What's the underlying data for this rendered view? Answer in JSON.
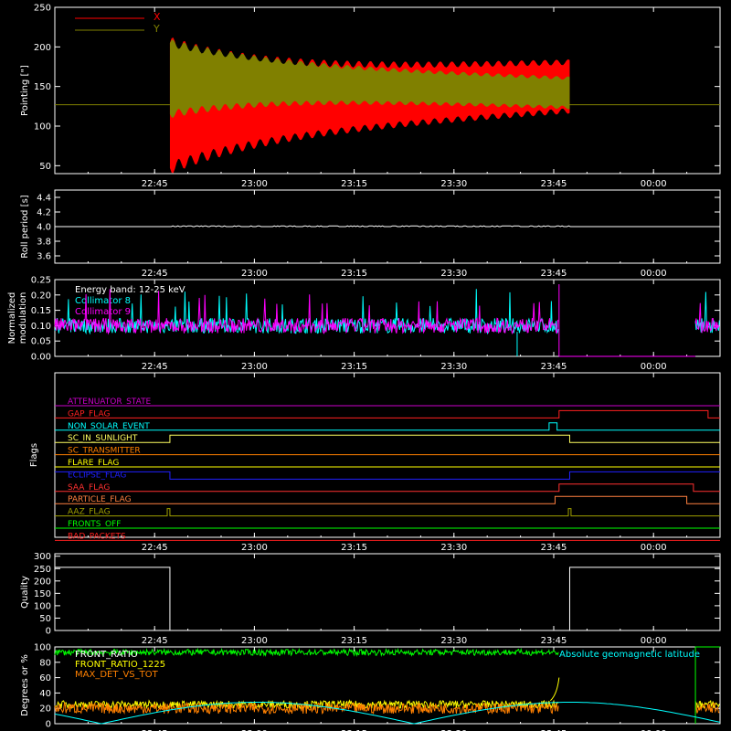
{
  "time_axis": {
    "start_minutes": 1350,
    "end_minutes": 1450,
    "tick_labels": [
      "22:45",
      "23:00",
      "23:15",
      "23:30",
      "23:45",
      "00:00"
    ],
    "tick_minutes": [
      1365,
      1380,
      1395,
      1410,
      1425,
      1440
    ]
  },
  "chart_data": [
    {
      "type": "area",
      "id": "pointing",
      "ylabel": "Pointing [\"]",
      "ylim": [
        40,
        250
      ],
      "yticks": [
        50,
        100,
        150,
        200,
        250
      ],
      "legend": "top-left",
      "series": [
        {
          "name": "X",
          "color": "#ff0000",
          "start": 1367.3,
          "end": 1427.4,
          "center": 140,
          "half_start": 70,
          "half_end": 30,
          "baseline": 127
        },
        {
          "name": "Y",
          "color": "#808000",
          "start": 1367.3,
          "end": 1427.4,
          "center": 160,
          "half_start": 45,
          "half_end": 18,
          "baseline": 127
        }
      ]
    },
    {
      "type": "line",
      "id": "roll",
      "ylabel": "Roll period [s]",
      "ylim": [
        3.5,
        4.5
      ],
      "yticks": [
        3.6,
        3.8,
        4.0,
        4.2,
        4.4
      ],
      "series": [
        {
          "name": "",
          "color": "#ffffff",
          "value": 4.0
        }
      ]
    },
    {
      "type": "line",
      "id": "modulation",
      "ylabel": "Normalized modulation",
      "ylim": [
        0,
        0.25
      ],
      "yticks": [
        0.0,
        0.05,
        0.1,
        0.15,
        0.2,
        0.25
      ],
      "legend": "top-left",
      "annotation": "Energy band: 12-25 keV",
      "series": [
        {
          "name": "Collimator 8",
          "color": "#00ffff",
          "mean": 0.1
        },
        {
          "name": "Collimator 9",
          "color": "#ff00ff",
          "mean": 0.1
        }
      ]
    },
    {
      "type": "line",
      "id": "flags",
      "ylabel": "Flags",
      "series": [
        {
          "name": "ATTENUATOR_STATE",
          "color": "#cc00cc",
          "changes": []
        },
        {
          "name": "GAP_FLAG",
          "color": "#ff2020",
          "changes": [
            [
              1425.8,
              1
            ],
            [
              1448.2,
              0
            ]
          ]
        },
        {
          "name": "NON_SOLAR_EVENT",
          "color": "#00ffff",
          "changes": [
            [
              1424.3,
              1
            ],
            [
              1425.5,
              0
            ]
          ]
        },
        {
          "name": "SC_IN_SUNLIGHT",
          "color": "#ffff60",
          "changes": [
            [
              1367.3,
              1
            ],
            [
              1427.4,
              0
            ]
          ]
        },
        {
          "name": "SC_TRANSMITTER",
          "color": "#ff8000",
          "changes": []
        },
        {
          "name": "FLARE_FLAG",
          "color": "#ffff00",
          "changes": []
        },
        {
          "name": "ECLIPSE_FLAG",
          "color": "#2020ff",
          "initial": 1,
          "changes": [
            [
              1367.3,
              0
            ],
            [
              1427.4,
              1
            ]
          ]
        },
        {
          "name": "SAA_FLAG",
          "color": "#ff3030",
          "changes": [
            [
              1425.8,
              1
            ],
            [
              1446.0,
              0
            ]
          ]
        },
        {
          "name": "PARTICLE_FLAG",
          "color": "#ff8040",
          "changes": [
            [
              1425.2,
              1
            ],
            [
              1445.0,
              0
            ]
          ]
        },
        {
          "name": "AAZ_FLAG",
          "color": "#a0a000",
          "changes": [
            [
              1366.9,
              1
            ],
            [
              1367.3,
              0
            ],
            [
              1427.2,
              1
            ],
            [
              1427.6,
              0
            ]
          ]
        },
        {
          "name": "FRONTS_OFF",
          "color": "#00ff00",
          "changes": []
        },
        {
          "name": "BAD_PACKETS",
          "color": "#ff2020",
          "changes": []
        }
      ]
    },
    {
      "type": "line",
      "id": "quality",
      "ylabel": "Quality",
      "ylim": [
        0,
        310
      ],
      "yticks": [
        0,
        50,
        100,
        150,
        200,
        250,
        300
      ],
      "series": [
        {
          "name": "",
          "color": "#ffffff",
          "segments": [
            [
              1350,
              1367.3,
              255
            ],
            [
              1367.3,
              1427.4,
              0
            ],
            [
              1427.4,
              1450,
              255
            ]
          ]
        }
      ]
    },
    {
      "type": "line",
      "id": "degrees",
      "ylabel": "Degrees or %",
      "ylim": [
        0,
        100
      ],
      "yticks": [
        0,
        20,
        40,
        60,
        80,
        100
      ],
      "legend": "top-left",
      "series": [
        {
          "name": "FRONT_RATIO",
          "color": "#ffffff",
          "mean": 93
        },
        {
          "name": "FRONT_RATIO_1225",
          "color": "#ffff00",
          "mean": 25
        },
        {
          "name": "MAX_DET_VS_TOT",
          "color": "#ff8000",
          "mean": 20
        },
        {
          "name": "Absolute geomagnetic latitude",
          "color": "#00ffff",
          "mean": 15
        }
      ]
    }
  ]
}
